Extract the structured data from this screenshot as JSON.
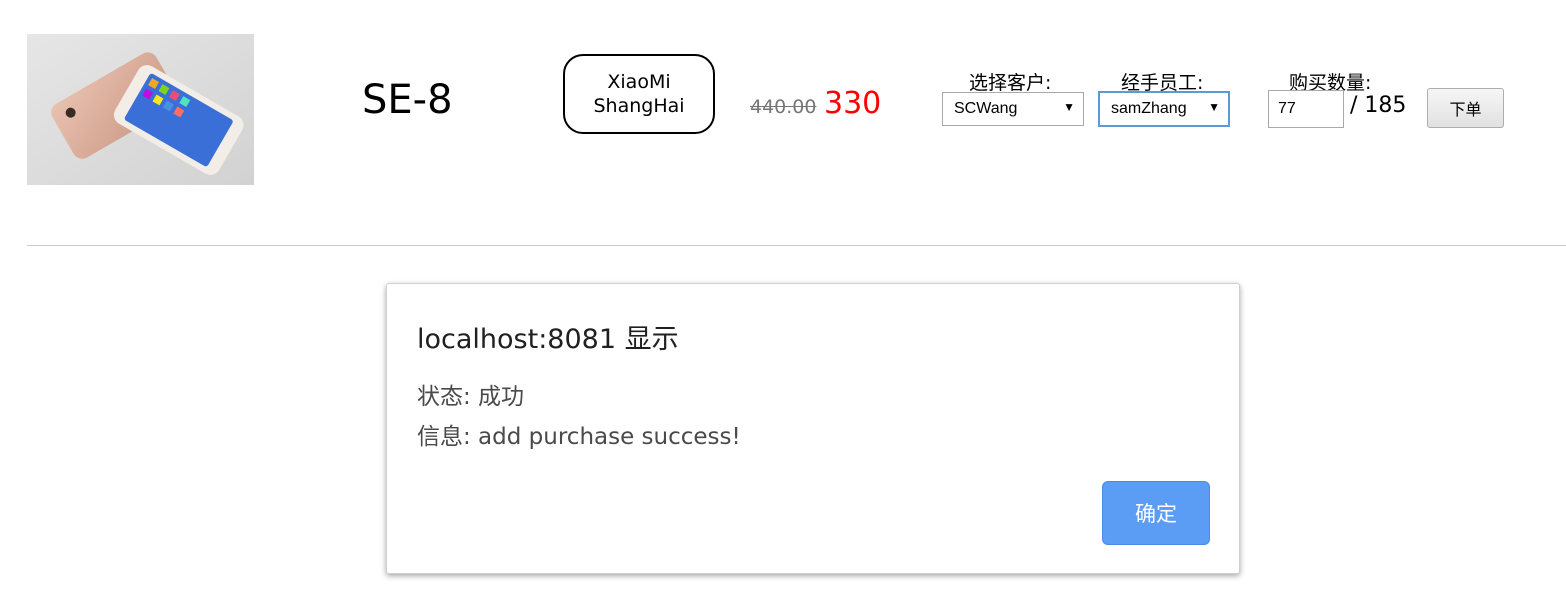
{
  "product": {
    "name": "SE-8",
    "vendor_line1": "XiaoMi",
    "vendor_line2": "ShangHai",
    "old_price": "440.00",
    "new_price": "330"
  },
  "form": {
    "customer_label": "选择客户:",
    "customer_value": "SCWang",
    "employee_label": "经手员工:",
    "employee_value": "samZhang",
    "quantity_label": "购买数量:",
    "quantity_value": "77",
    "stock_text": "/ 185",
    "order_button": "下单"
  },
  "dialog": {
    "title": "localhost:8081 显示",
    "status_line": "状态: 成功",
    "info_line": "信息: add purchase success!",
    "ok_button": "确定"
  },
  "colors": {
    "new_price": "#ff0000",
    "ok_button": "#5b9cf5"
  }
}
